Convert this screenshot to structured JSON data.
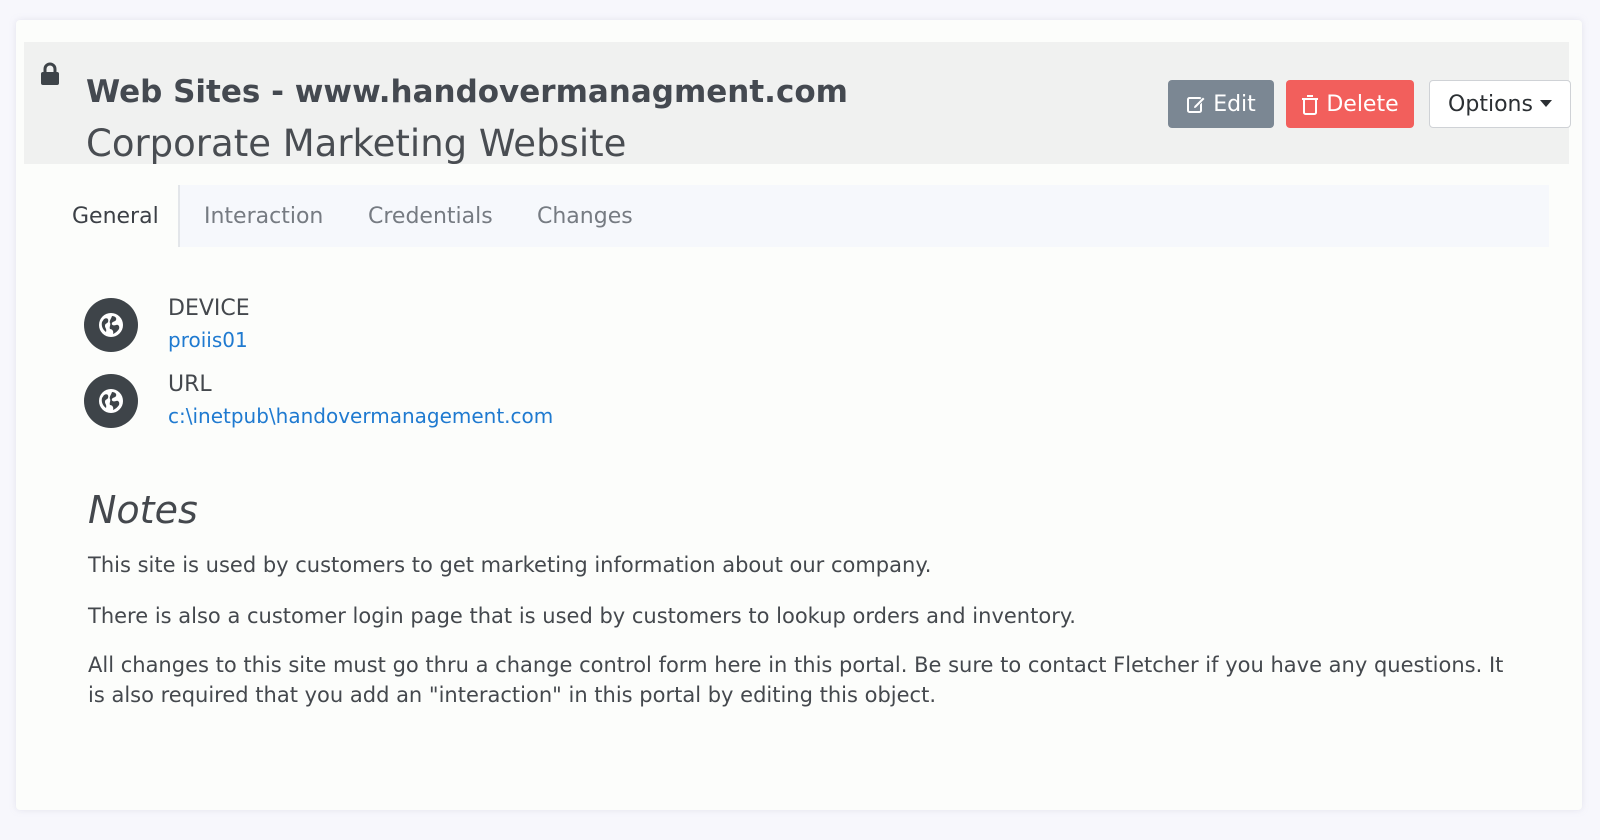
{
  "header": {
    "title": "Web Sites - www.handovermanagment.com",
    "subtitle": "Corporate Marketing Website",
    "lock_icon": "lock-icon"
  },
  "actions": {
    "edit_label": "Edit",
    "delete_label": "Delete",
    "options_label": "Options",
    "edit_color": "#7b8793",
    "delete_color": "#f25f5c"
  },
  "tabs": [
    {
      "label": "General",
      "active": true
    },
    {
      "label": "Interaction",
      "active": false
    },
    {
      "label": "Credentials",
      "active": false
    },
    {
      "label": "Changes",
      "active": false
    }
  ],
  "fields": [
    {
      "label": "DEVICE",
      "value": "proiis01",
      "icon": "globe-icon"
    },
    {
      "label": "URL",
      "value": "c:\\inetpub\\handovermanagement.com",
      "icon": "globe-icon"
    }
  ],
  "notes": {
    "heading": "Notes",
    "paragraphs": [
      "This site is used by customers to get marketing information about our company.",
      "There is also a customer login page that is used by customers to lookup orders and inventory.",
      "All changes to this site must go thru a change control form here in this portal.  Be sure to contact Fletcher if you have any questions.  It is also required that you add an \"interaction\" in this portal by editing this object."
    ]
  }
}
